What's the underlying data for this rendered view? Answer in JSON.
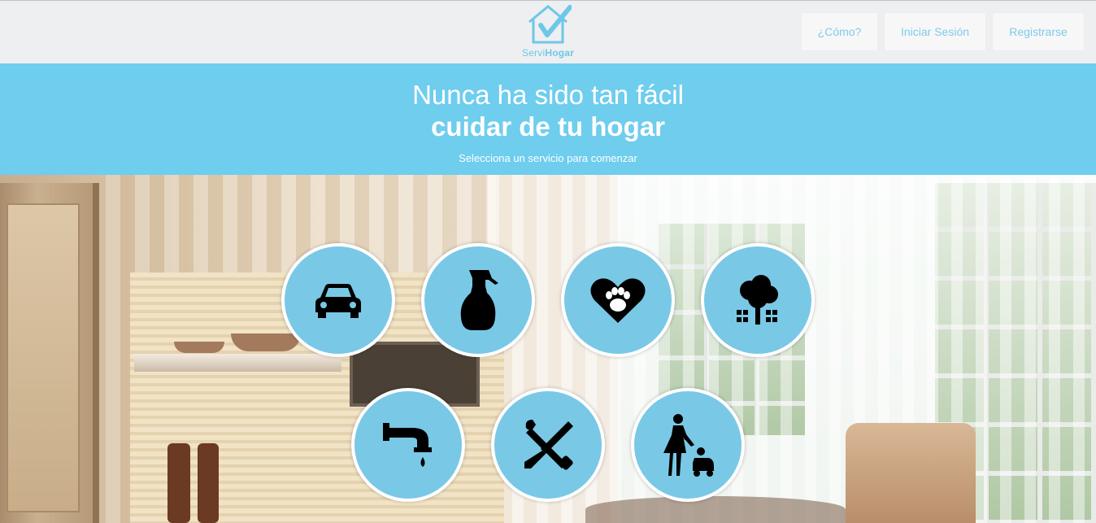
{
  "brand": {
    "name_part1": "Servi",
    "name_part2": "Hogar",
    "accent_color": "#6fcdee"
  },
  "nav": {
    "como_label": "¿Cómo?",
    "login_label": "Iniciar Sesión",
    "register_label": "Registrarse"
  },
  "hero": {
    "line1": "Nunca ha sido tan fácil",
    "line2": "cuidar de tu hogar",
    "subtitle": "Selecciona un servicio para comenzar"
  },
  "services": [
    {
      "icon": "car-icon"
    },
    {
      "icon": "spray-bottle-icon"
    },
    {
      "icon": "pet-heart-icon"
    },
    {
      "icon": "tree-garden-icon"
    },
    {
      "icon": "faucet-icon"
    },
    {
      "icon": "wrench-screwdriver-icon"
    },
    {
      "icon": "babysitter-icon"
    }
  ]
}
